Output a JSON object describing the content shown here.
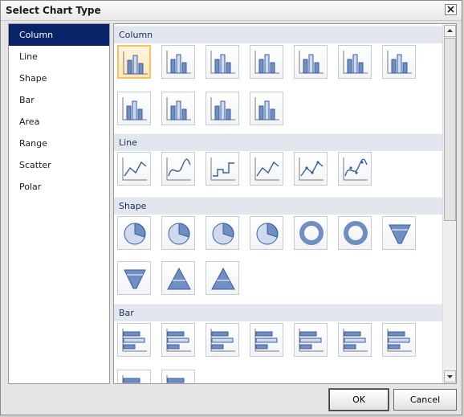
{
  "window": {
    "title": "Select Chart Type"
  },
  "nav": {
    "items": [
      {
        "label": "Column",
        "selected": true
      },
      {
        "label": "Line"
      },
      {
        "label": "Shape"
      },
      {
        "label": "Bar"
      },
      {
        "label": "Area"
      },
      {
        "label": "Range"
      },
      {
        "label": "Scatter"
      },
      {
        "label": "Polar"
      }
    ]
  },
  "gallery": {
    "sections": [
      {
        "label": "Column",
        "icons": [
          "clustered-column-icon",
          "stacked-column-icon",
          "100-stacked-column-icon",
          "3d-clustered-column-icon",
          "3d-stacked-column-icon",
          "3d-100-stacked-column-icon",
          "3d-column-icon",
          "cylinder-column-icon",
          "stacked-cylinder-icon",
          "100-stacked-cylinder-icon",
          "3d-cylinder-icon"
        ],
        "selected_index": 0
      },
      {
        "label": "Line",
        "icons": [
          "line-icon",
          "smooth-line-icon",
          "stepline-icon",
          "3d-line-icon",
          "line-markers-icon",
          "smooth-line-markers-icon"
        ]
      },
      {
        "label": "Shape",
        "icons": [
          "pie-icon",
          "exploded-pie-icon",
          "3d-pie-icon",
          "3d-exploded-pie-icon",
          "doughnut-icon",
          "exploded-doughnut-icon",
          "funnel-icon",
          "3d-funnel-icon",
          "pyramid-icon",
          "3d-pyramid-icon"
        ]
      },
      {
        "label": "Bar",
        "icons": [
          "clustered-bar-icon",
          "stacked-bar-icon",
          "100-stacked-bar-icon",
          "3d-clustered-bar-icon",
          "3d-stacked-bar-icon",
          "3d-100-stacked-bar-icon",
          "cylinder-bar-icon",
          "3d-cylinder-bar-icon",
          "stacked-cylinder-bar-icon"
        ]
      }
    ]
  },
  "buttons": {
    "ok": "OK",
    "cancel": "Cancel"
  },
  "colors": {
    "selection": "#0a246a",
    "thumb_highlight": "#f5c35d",
    "section_header": "#e2e7ef"
  }
}
